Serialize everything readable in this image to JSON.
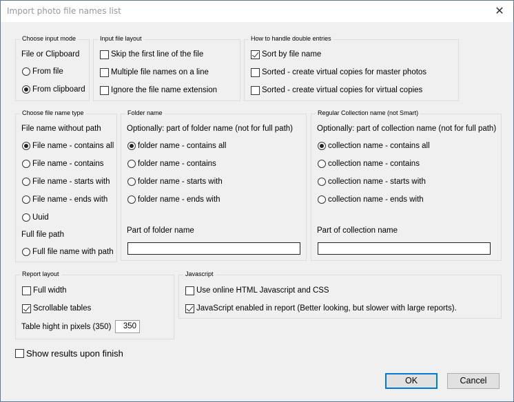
{
  "window": {
    "title": "Import photo file names list",
    "close_glyph": "✕"
  },
  "input_mode": {
    "legend": "Choose input mode",
    "label": "File or Clipboard",
    "options": [
      {
        "label": "From file",
        "selected": false
      },
      {
        "label": "From clipboard",
        "selected": true
      }
    ]
  },
  "input_layout": {
    "legend": "Input file layout",
    "options": [
      {
        "label": "Skip the first line of the file",
        "checked": false
      },
      {
        "label": "Multiple file names on a line",
        "checked": false
      },
      {
        "label": "Ignore the file name extension",
        "checked": false
      }
    ]
  },
  "double_entries": {
    "legend": "How to handle double entries",
    "options": [
      {
        "label": "Sort by file name",
        "checked": true
      },
      {
        "label": "Sorted - create virtual copies for master photos",
        "checked": false
      },
      {
        "label": "Sorted - create virtual copies for virtual copies",
        "checked": false
      }
    ]
  },
  "file_name_type": {
    "legend": "Choose file name type",
    "label_without_path": "File name without path",
    "options": [
      {
        "label": "File name - contains all",
        "selected": true
      },
      {
        "label": "File name - contains",
        "selected": false
      },
      {
        "label": "File name - starts with",
        "selected": false
      },
      {
        "label": "File name - ends with",
        "selected": false
      },
      {
        "label": "Uuid",
        "selected": false
      }
    ],
    "label_full_path": "Full file path",
    "full_path_option": {
      "label": "Full file name with path",
      "selected": false
    }
  },
  "folder_name": {
    "legend": "Folder name",
    "hint": "Optionally: part of folder name (not for full path)",
    "options": [
      {
        "label": "folder name - contains all",
        "selected": true
      },
      {
        "label": "folder name - contains",
        "selected": false
      },
      {
        "label": "folder name - starts with",
        "selected": false
      },
      {
        "label": "folder name - ends with",
        "selected": false
      }
    ],
    "field_label": "Part of folder name",
    "field_value": ""
  },
  "collection_name": {
    "legend": "Regular Collection name (not Smart)",
    "hint": "Optionally: part of collection name (not for full path)",
    "options": [
      {
        "label": "collection name - contains all",
        "selected": true
      },
      {
        "label": "collection name - contains",
        "selected": false
      },
      {
        "label": "collection name - starts with",
        "selected": false
      },
      {
        "label": "collection name - ends with",
        "selected": false
      }
    ],
    "field_label": "Part of collection name",
    "field_value": ""
  },
  "report_layout": {
    "legend": "Report layout",
    "options": [
      {
        "label": "Full width",
        "checked": false
      },
      {
        "label": "Scrollable tables",
        "checked": true
      }
    ],
    "table_height_label": "Table hight in pixels (350)",
    "table_height_value": "350"
  },
  "javascript": {
    "legend": "Javascript",
    "options": [
      {
        "label": "Use online HTML Javascript and CSS",
        "checked": false
      },
      {
        "label": "JavaScript enabled in report (Better looking, but slower with large reports).",
        "checked": true
      }
    ]
  },
  "show_results": {
    "label": "Show results upon finish",
    "checked": false
  },
  "buttons": {
    "ok": "OK",
    "cancel": "Cancel"
  }
}
